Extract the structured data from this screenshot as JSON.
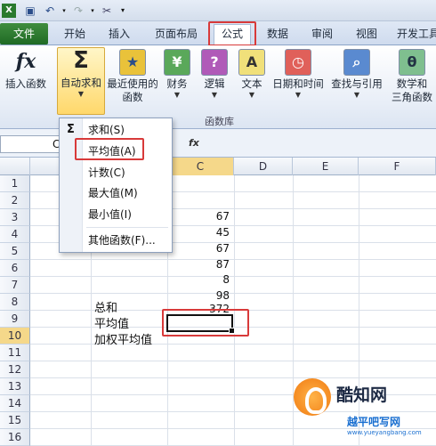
{
  "tabs": [
    "文件",
    "开始",
    "插入",
    "页面布局",
    "公式",
    "数据",
    "审阅",
    "视图",
    "开发工具"
  ],
  "ribbon": {
    "insert_function": "插入函数",
    "autosum": "自动求和",
    "recent": [
      "最近使用的",
      "函数"
    ],
    "finance": "财务",
    "logic": "逻辑",
    "text": "文本",
    "datetime": "日期和时间",
    "lookup": "查找与引用",
    "math": [
      "数学和",
      "三角函数"
    ],
    "group_label": "函数库"
  },
  "name_box": "C",
  "fx_label": "fx",
  "columns": [
    "C",
    "D",
    "E",
    "F"
  ],
  "rows": [
    "1",
    "2",
    "3",
    "4",
    "5",
    "6",
    "7",
    "8",
    "9",
    "10",
    "11",
    "12",
    "13",
    "14",
    "15",
    "16"
  ],
  "values": [
    "67",
    "45",
    "67",
    "87",
    "8",
    "98",
    "372"
  ],
  "labels": [
    "总和",
    "平均值",
    "加权平均值"
  ],
  "menu": [
    "求和(S)",
    "平均值(A)",
    "计数(C)",
    "最大值(M)",
    "最小值(I)",
    "其他函数(F)..."
  ],
  "watermark": {
    "title": "酷知网",
    "subtitle": "越平吧写网",
    "url": "www.yueyangbang.com"
  },
  "colors": {
    "file_tab": "#2a7a2e",
    "highlight": "#d83a3a",
    "selected_button": "#ffd86b"
  }
}
